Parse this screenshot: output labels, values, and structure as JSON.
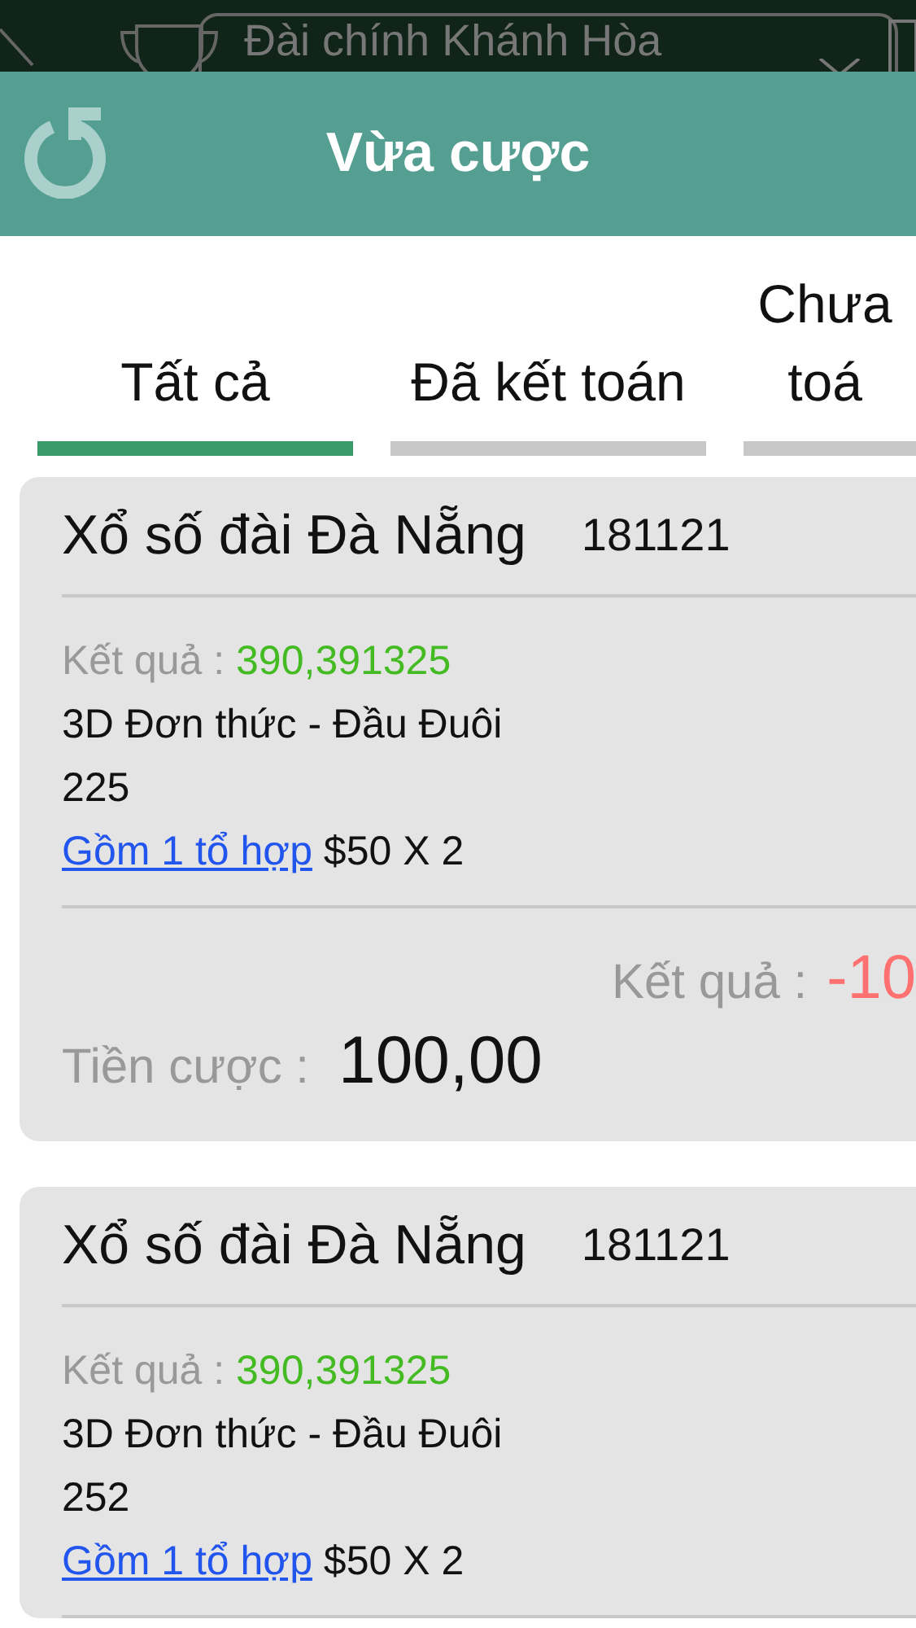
{
  "background": {
    "selector": "Đài chính Khánh Hòa"
  },
  "header": {
    "title": "Vừa cược"
  },
  "tabs": [
    {
      "label": "Tất cả",
      "selected": true
    },
    {
      "label": "Đã kết toán",
      "selected": false
    },
    {
      "label": "Chưa toá",
      "selected": false
    }
  ],
  "bets": [
    {
      "title": "Xổ số đài Đà Nẵng",
      "period": "181121",
      "result_label": "Kết quả :",
      "result_numbers": "390,391325",
      "bet_type": "3D Đơn thức - Đầu Đuôi",
      "number": "225",
      "combo_link": "Gồm 1 tổ hợp",
      "stake_detail": "$50 X 2",
      "win_label": "Kết quả :",
      "win_value": "-10",
      "amount_label": "Tiền cược :",
      "amount": "100,00"
    },
    {
      "title": "Xổ số đài Đà Nẵng",
      "period": "181121",
      "result_label": "Kết quả :",
      "result_numbers": "390,391325",
      "bet_type": "3D Đơn thức - Đầu Đuôi",
      "number": "252",
      "combo_link": "Gồm 1 tổ hợp",
      "stake_detail": "$50 X 2"
    }
  ]
}
